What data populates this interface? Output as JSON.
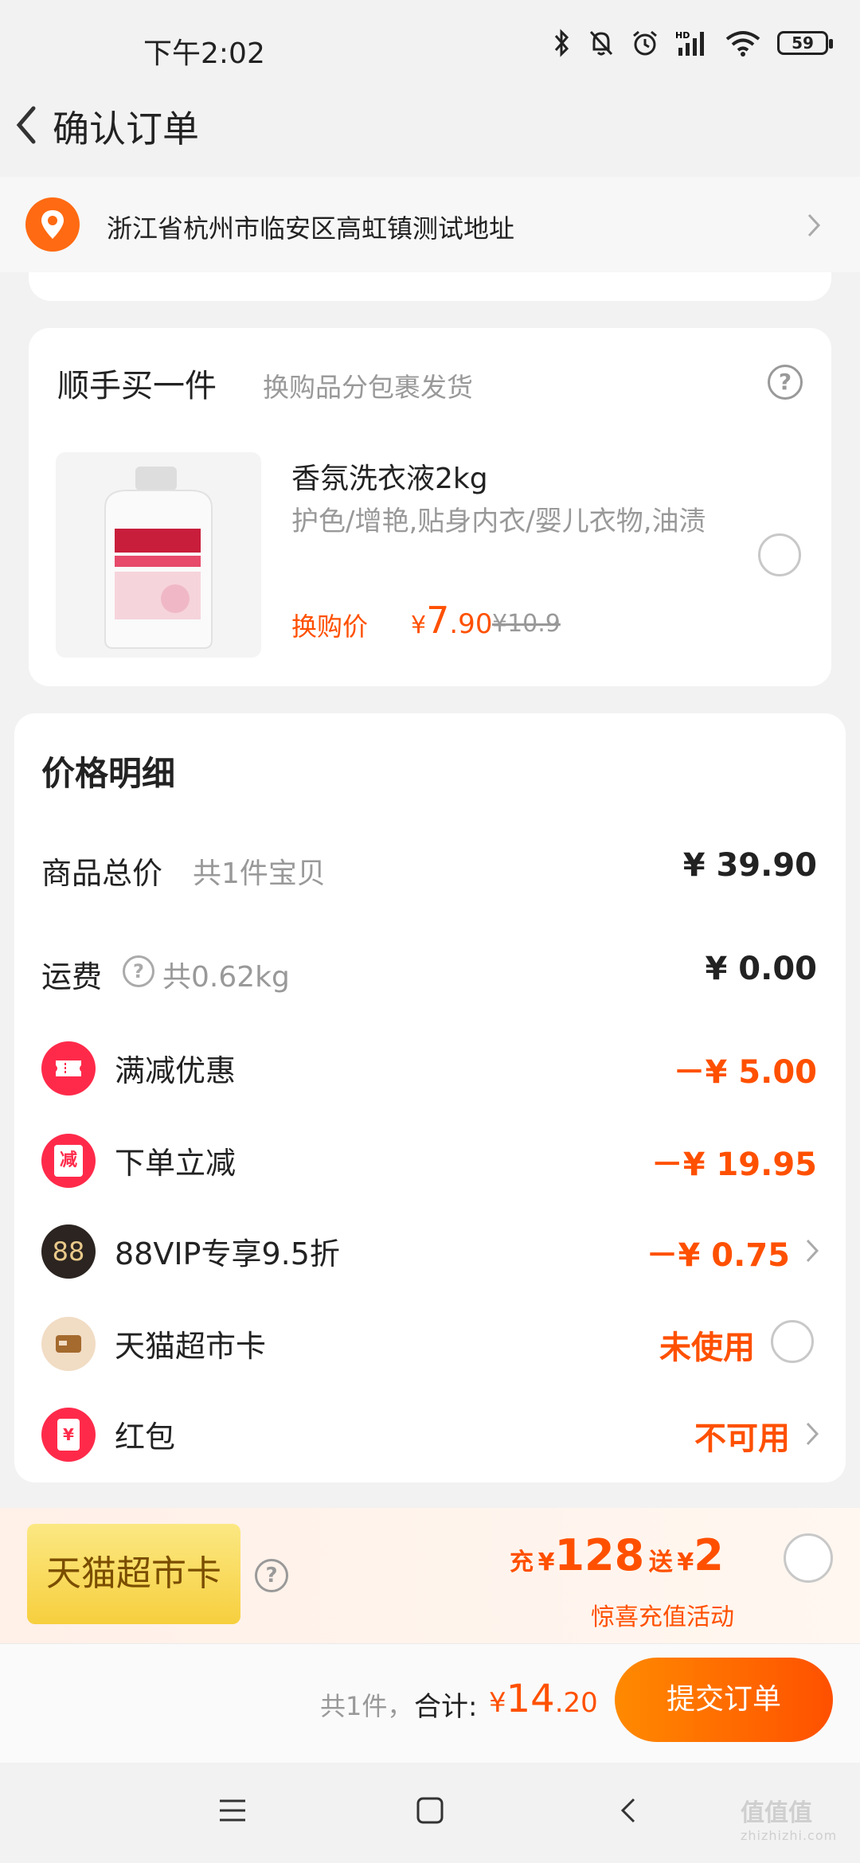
{
  "status_bar": {
    "time": "下午2:02",
    "battery": "59"
  },
  "header": {
    "title": "确认订单"
  },
  "address": {
    "text": "浙江省杭州市临安区高虹镇测试地址"
  },
  "addon": {
    "title": "顺手买一件",
    "subtitle": "换购品分包裹发货",
    "product": {
      "name": "香氛洗衣液2kg",
      "desc": "护色/增艳,贴身内衣/婴儿衣物,油渍",
      "price_label": "换购价",
      "currency": "¥",
      "price_int": "7",
      "price_dec": ".90",
      "orig_price": "¥10.9"
    }
  },
  "detail": {
    "title": "价格明细",
    "rows": [
      {
        "label": "商品总价",
        "sub": "共1件宝贝",
        "value": "¥ 39.90"
      },
      {
        "label": "运费",
        "sub": "共0.62kg",
        "value": "¥ 0.00"
      },
      {
        "label": "满减优惠",
        "value": "－¥ 5.00",
        "icon": "coupon-icon"
      },
      {
        "label": "下单立减",
        "value": "－¥ 19.95",
        "icon": "discount-icon",
        "icon_text": "减"
      },
      {
        "label": "88VIP专享9.5折",
        "value": "－¥ 0.75",
        "icon": "vip-88-icon",
        "icon_text": "88"
      },
      {
        "label": "天猫超市卡",
        "value": "未使用",
        "icon": "card-icon"
      },
      {
        "label": "红包",
        "value": "不可用",
        "icon": "red-packet-icon",
        "icon_text": "¥"
      }
    ]
  },
  "promo": {
    "badge": "天猫超市卡",
    "charge_label": "充",
    "charge_currency": "¥",
    "charge_amount": "128",
    "gift_label": "送",
    "gift_currency": "¥",
    "gift_amount": "2",
    "desc": "惊喜充值活动"
  },
  "bottom": {
    "count": "共1件，",
    "total_label": "合计:",
    "currency": "¥",
    "total_int": "14",
    "total_dec": ".20",
    "submit": "提交订单"
  },
  "watermark": {
    "main": "值值值",
    "sub": "zhizhizhi.com"
  },
  "colors": {
    "accent": "#ff5000",
    "location": "#ff6a12",
    "badge_gold": "#f7cf3e"
  }
}
